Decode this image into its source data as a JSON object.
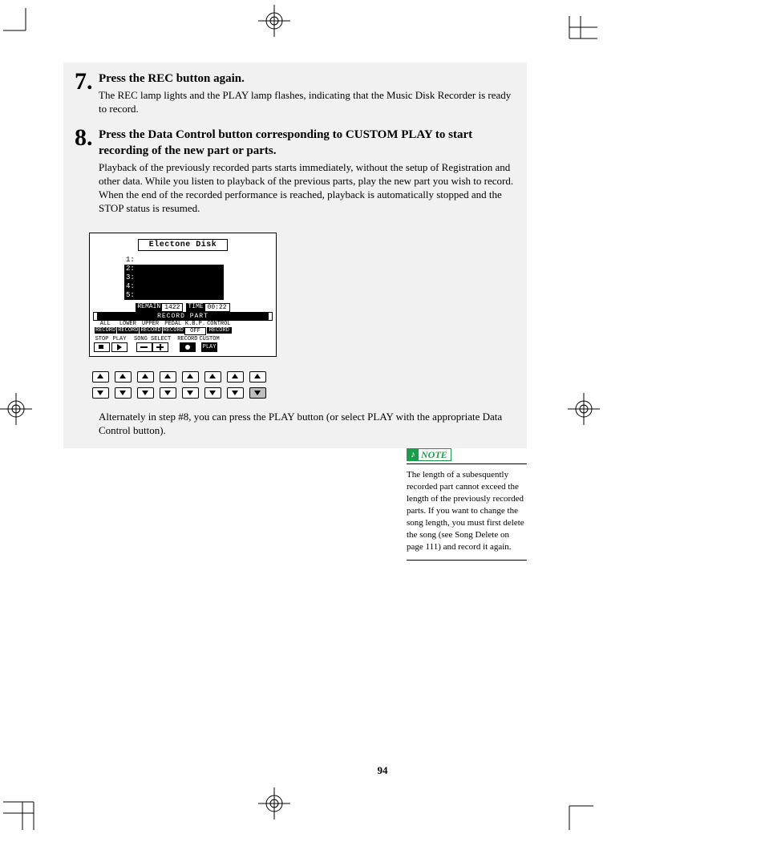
{
  "page_number": "94",
  "steps": [
    {
      "num": "7.",
      "heading": "Press the REC button again.",
      "text": "The REC lamp lights and the PLAY lamp flashes, indicating that the Music Disk Recorder is ready to record."
    },
    {
      "num": "8.",
      "heading": "Press the Data Control button corresponding to CUSTOM PLAY to start recording of the new part or parts.",
      "text": "Playback of the previously recorded parts starts immediately, without the setup of Registration and other data.  While you listen to playback of the previous parts, play the new part you wish to record.  When the end of the recorded performance is reached, playback is automatically stopped and the STOP status is resumed."
    }
  ],
  "closing": "Alternately in step #8, you can press the PLAY button (or select PLAY with the appropriate Data Control button).",
  "lcd": {
    "title": "Electone Disk",
    "list_top": "1:",
    "list": [
      "2:",
      "3:",
      "4:",
      "5:"
    ],
    "remain_k": "REMAIN",
    "remain_v": "1422",
    "time_k": "TIME",
    "time_v": "00:22",
    "bar": "RECORD PART",
    "parts_top": [
      "ALL",
      "LOWER",
      "UPPER",
      "",
      "PEDAL",
      "K.B.P.",
      "CONTROL"
    ],
    "parts_bottom": [
      "RECORD",
      "RECORD",
      "RECORD",
      "",
      "RECORD",
      "OFF",
      "RECORD"
    ],
    "transport": {
      "stop": "STOP",
      "play": "PLAY",
      "song": "SONG SELECT",
      "rec": "RECORD",
      "custom": "CUSTOM",
      "playbtn": "PLAY"
    }
  },
  "note": {
    "label": "NOTE",
    "text": "The length of a subesquently recorded part cannot exceed the length of the previously recorded parts.  If you want to change the song length, you must first delete the song (see Song Delete on page 111) and record it again."
  }
}
